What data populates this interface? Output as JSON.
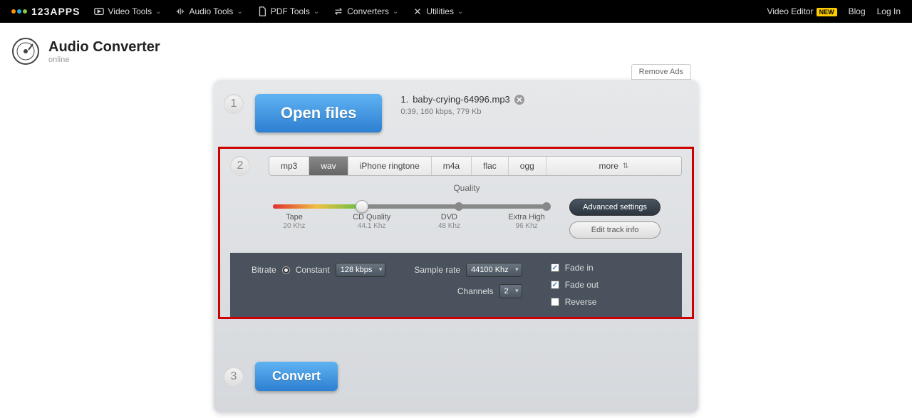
{
  "nav": {
    "brand": "123APPS",
    "items": [
      "Video Tools",
      "Audio Tools",
      "PDF Tools",
      "Converters",
      "Utilities"
    ],
    "right": {
      "videoEditor": "Video Editor",
      "new": "NEW",
      "blog": "Blog",
      "login": "Log In"
    }
  },
  "app": {
    "title": "Audio Converter",
    "sub": "online"
  },
  "panel": {
    "removeAds": "Remove Ads",
    "openFiles": "Open files",
    "file": {
      "index": "1.",
      "name": "baby-crying-64996.mp3",
      "meta": "0:39, 160 kbps, 779 Kb"
    },
    "formats": [
      "mp3",
      "wav",
      "iPhone ringtone",
      "m4a",
      "flac",
      "ogg",
      "more"
    ],
    "activeFormat": "wav",
    "quality": {
      "label": "Quality",
      "stops": [
        {
          "name": "Tape",
          "sub": "20 Khz"
        },
        {
          "name": "CD Quality",
          "sub": "44.1 Khz"
        },
        {
          "name": "DVD",
          "sub": "48 Khz"
        },
        {
          "name": "Extra High",
          "sub": "96 Khz"
        }
      ]
    },
    "sideBtns": {
      "adv": "Advanced settings",
      "edit": "Edit track info"
    },
    "adv": {
      "bitrateLabel": "Bitrate",
      "constant": "Constant",
      "bitrateValue": "128 kbps",
      "sampleRateLabel": "Sample rate",
      "sampleRateValue": "44100 Khz",
      "channelsLabel": "Channels",
      "channelsValue": "2",
      "fadeIn": "Fade in",
      "fadeOut": "Fade out",
      "reverse": "Reverse"
    },
    "convert": "Convert"
  },
  "colors": {
    "logo": [
      "#ff9500",
      "#29abe2",
      "#8cc63f",
      "#ff3b30"
    ]
  }
}
